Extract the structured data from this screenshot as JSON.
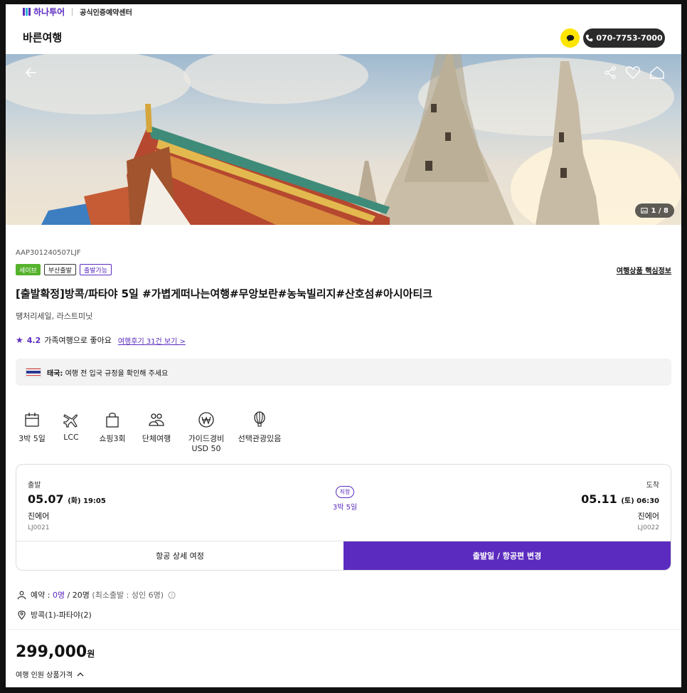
{
  "header": {
    "brand_name": "하나투어",
    "brand_cert": "공식인증예약센터",
    "page_title": "바른여행",
    "phone": "070-7753-7000"
  },
  "hero": {
    "image_counter": "1 / 8",
    "icons": [
      "back-arrow-icon",
      "share-icon",
      "heart-icon",
      "home-icon",
      "image-icon"
    ]
  },
  "product": {
    "code": "AAP301240507LJF",
    "badges": [
      "세이브",
      "부산출발",
      "출발가능"
    ],
    "core_info_link": "여행상품 핵심정보",
    "title": "[출발확정]방콕/파타야 5일 #가볍게떠나는여행#무앙보란#농눅빌리지#산호섬#아시아티크",
    "subtitle": "땡처리세일, 라스트미닛",
    "rating_score": "4.2",
    "rating_text": "가족여행으로 좋아요",
    "review_link": "여행후기 31건 보기 >"
  },
  "notice": {
    "country": "태국:",
    "text": "여행 전 입국 규정을 확인해 주세요"
  },
  "features": [
    {
      "icon": "calendar-icon",
      "label": "3박 5일",
      "sub": ""
    },
    {
      "icon": "airplane-icon",
      "label": "LCC",
      "sub": ""
    },
    {
      "icon": "shopping-bag-icon",
      "label": "쇼핑3회",
      "sub": ""
    },
    {
      "icon": "group-icon",
      "label": "단체여행",
      "sub": ""
    },
    {
      "icon": "won-coin-icon",
      "label": "가이드경비",
      "sub": "USD 50"
    },
    {
      "icon": "balloon-icon",
      "label": "선택관광있음",
      "sub": ""
    }
  ],
  "flight": {
    "departure": {
      "label": "출발",
      "date": "05.07",
      "time": "(화) 19:05",
      "airline": "진에어",
      "flight_no": "LJ0021"
    },
    "arrival": {
      "label": "도착",
      "date": "05.11",
      "time": "(토) 06:30",
      "airline": "진에어",
      "flight_no": "LJ0022"
    },
    "direct": "직항",
    "duration": "3박 5일",
    "detail_button": "항공 상세 여정",
    "change_button": "출발일 / 항공편 변경"
  },
  "booking": {
    "label": "예약 :",
    "booked": "0명",
    "total": "/ 20명",
    "min": "(최소출발 : 성인 6명)"
  },
  "route": "방콕(1)-파타야(2)",
  "price": {
    "amount": "299,000",
    "unit": "원",
    "label": "여행 인원 상품가격"
  },
  "colors": {
    "accent": "#5b2bbf",
    "save_badge": "#55b22c",
    "kakao": "#fee500"
  }
}
